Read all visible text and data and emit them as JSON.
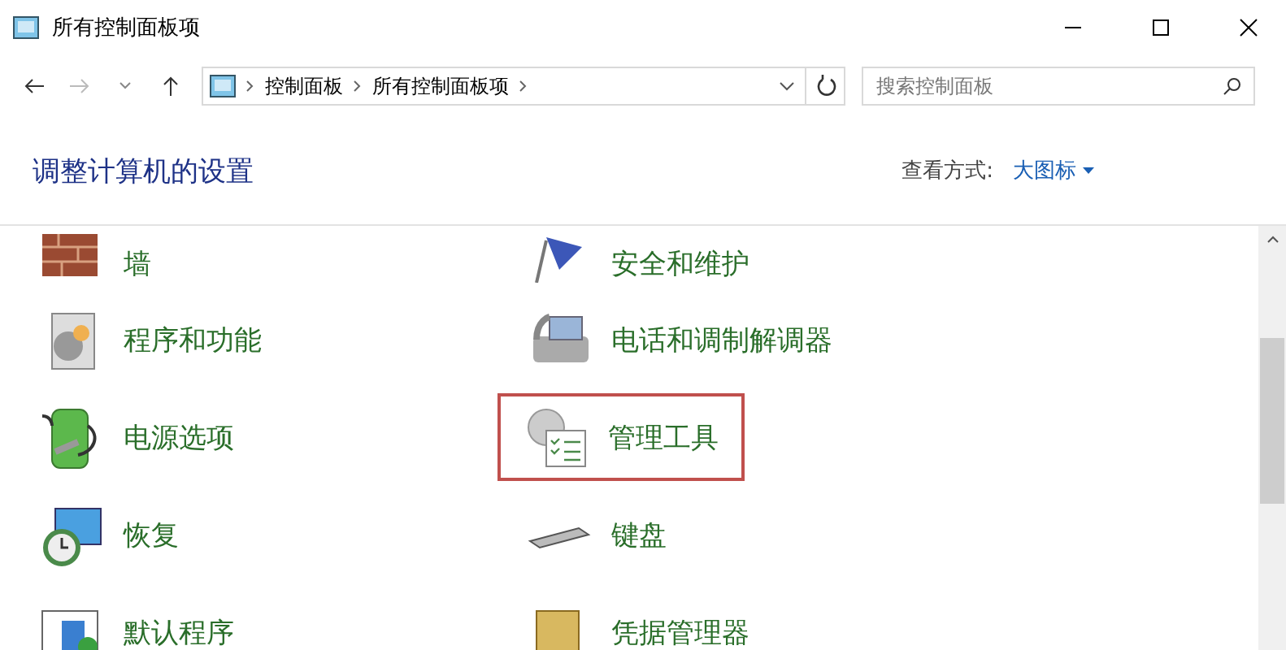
{
  "window": {
    "title": "所有控制面板项"
  },
  "address_bar": {
    "breadcrumbs": [
      "控制面板",
      "所有控制面板项"
    ]
  },
  "search": {
    "placeholder": "搜索控制面板"
  },
  "header": {
    "title": "调整计算机的设置",
    "view_label": "查看方式:",
    "view_value": "大图标"
  },
  "items": [
    {
      "label": "墙",
      "selected": false
    },
    {
      "label": "安全和维护",
      "selected": false
    },
    {
      "label": "程序和功能",
      "selected": false
    },
    {
      "label": "电话和调制解调器",
      "selected": false
    },
    {
      "label": "电源选项",
      "selected": false
    },
    {
      "label": "管理工具",
      "selected": true
    },
    {
      "label": "恢复",
      "selected": false
    },
    {
      "label": "键盘",
      "selected": false
    },
    {
      "label": "默认程序",
      "selected": false
    },
    {
      "label": "凭据管理器",
      "selected": false
    }
  ]
}
